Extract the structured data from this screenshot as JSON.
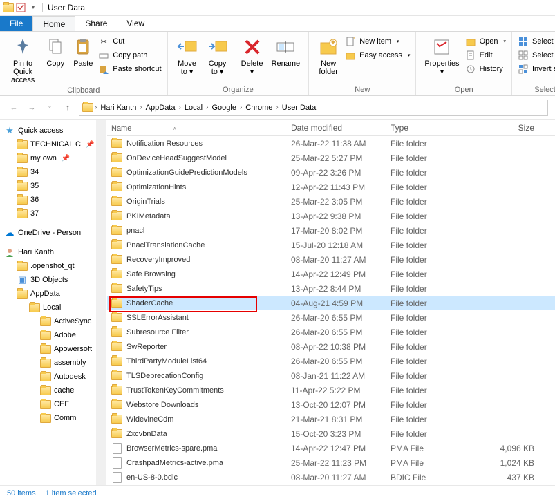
{
  "title_bar": {
    "title": "User Data"
  },
  "tabs": {
    "file": "File",
    "home": "Home",
    "share": "Share",
    "view": "View"
  },
  "ribbon": {
    "clipboard": {
      "label": "Clipboard",
      "pin": "Pin to Quick\naccess",
      "copy": "Copy",
      "paste": "Paste",
      "cut": "Cut",
      "copy_path": "Copy path",
      "paste_shortcut": "Paste shortcut"
    },
    "organize": {
      "label": "Organize",
      "move_to": "Move\nto",
      "copy_to": "Copy\nto",
      "delete": "Delete",
      "rename": "Rename"
    },
    "new": {
      "label": "New",
      "new_folder": "New\nfolder",
      "new_item": "New item",
      "easy_access": "Easy access"
    },
    "open": {
      "label": "Open",
      "properties": "Properties",
      "open": "Open",
      "edit": "Edit",
      "history": "History"
    },
    "select": {
      "label": "Select",
      "select_all": "Select all",
      "select_none": "Select none",
      "invert": "Invert selection"
    }
  },
  "breadcrumb": [
    "Hari Kanth",
    "AppData",
    "Local",
    "Google",
    "Chrome",
    "User Data"
  ],
  "tree": {
    "quick_access": "Quick access",
    "technical": "TECHNICAL C",
    "my_own": "my own",
    "f34": "34",
    "f35": "35",
    "f36": "36",
    "f37": "37",
    "onedrive": "OneDrive - Person",
    "user": "Hari Kanth",
    "openshot": ".openshot_qt",
    "objects3d": "3D Objects",
    "appdata": "AppData",
    "local": "Local",
    "activesync": "ActiveSync",
    "adobe": "Adobe",
    "apowersoft": "Apowersoft",
    "assembly": "assembly",
    "autodesk": "Autodesk",
    "cache": "cache",
    "cef": "CEF",
    "comms": "Comms"
  },
  "columns": {
    "name": "Name",
    "date": "Date modified",
    "type": "Type",
    "size": "Size"
  },
  "files": [
    {
      "name": "Notification Resources",
      "date": "26-Mar-22 11:38 AM",
      "type": "File folder",
      "size": "",
      "icon": "folder"
    },
    {
      "name": "OnDeviceHeadSuggestModel",
      "date": "25-Mar-22 5:27 PM",
      "type": "File folder",
      "size": "",
      "icon": "folder"
    },
    {
      "name": "OptimizationGuidePredictionModels",
      "date": "09-Apr-22 3:26 PM",
      "type": "File folder",
      "size": "",
      "icon": "folder"
    },
    {
      "name": "OptimizationHints",
      "date": "12-Apr-22 11:43 PM",
      "type": "File folder",
      "size": "",
      "icon": "folder"
    },
    {
      "name": "OriginTrials",
      "date": "25-Mar-22 3:05 PM",
      "type": "File folder",
      "size": "",
      "icon": "folder"
    },
    {
      "name": "PKIMetadata",
      "date": "13-Apr-22 9:38 PM",
      "type": "File folder",
      "size": "",
      "icon": "folder"
    },
    {
      "name": "pnacl",
      "date": "17-Mar-20 8:02 PM",
      "type": "File folder",
      "size": "",
      "icon": "folder"
    },
    {
      "name": "PnaclTranslationCache",
      "date": "15-Jul-20 12:18 AM",
      "type": "File folder",
      "size": "",
      "icon": "folder"
    },
    {
      "name": "RecoveryImproved",
      "date": "08-Mar-20 11:27 AM",
      "type": "File folder",
      "size": "",
      "icon": "folder"
    },
    {
      "name": "Safe Browsing",
      "date": "14-Apr-22 12:49 PM",
      "type": "File folder",
      "size": "",
      "icon": "folder"
    },
    {
      "name": "SafetyTips",
      "date": "13-Apr-22 8:44 PM",
      "type": "File folder",
      "size": "",
      "icon": "folder"
    },
    {
      "name": "ShaderCache",
      "date": "04-Aug-21 4:59 PM",
      "type": "File folder",
      "size": "",
      "icon": "folder",
      "selected": true
    },
    {
      "name": "SSLErrorAssistant",
      "date": "26-Mar-20 6:55 PM",
      "type": "File folder",
      "size": "",
      "icon": "folder"
    },
    {
      "name": "Subresource Filter",
      "date": "26-Mar-20 6:55 PM",
      "type": "File folder",
      "size": "",
      "icon": "folder"
    },
    {
      "name": "SwReporter",
      "date": "08-Apr-22 10:38 PM",
      "type": "File folder",
      "size": "",
      "icon": "folder"
    },
    {
      "name": "ThirdPartyModuleList64",
      "date": "26-Mar-20 6:55 PM",
      "type": "File folder",
      "size": "",
      "icon": "folder"
    },
    {
      "name": "TLSDeprecationConfig",
      "date": "08-Jan-21 11:22 AM",
      "type": "File folder",
      "size": "",
      "icon": "folder"
    },
    {
      "name": "TrustTokenKeyCommitments",
      "date": "11-Apr-22 5:22 PM",
      "type": "File folder",
      "size": "",
      "icon": "folder"
    },
    {
      "name": "Webstore Downloads",
      "date": "13-Oct-20 12:07 PM",
      "type": "File folder",
      "size": "",
      "icon": "folder"
    },
    {
      "name": "WidevineCdm",
      "date": "21-Mar-21 8:31 PM",
      "type": "File folder",
      "size": "",
      "icon": "folder"
    },
    {
      "name": "ZxcvbnData",
      "date": "15-Oct-20 3:23 PM",
      "type": "File folder",
      "size": "",
      "icon": "folder"
    },
    {
      "name": "BrowserMetrics-spare.pma",
      "date": "14-Apr-22 12:47 PM",
      "type": "PMA File",
      "size": "4,096 KB",
      "icon": "file"
    },
    {
      "name": "CrashpadMetrics-active.pma",
      "date": "25-Mar-22 11:23 PM",
      "type": "PMA File",
      "size": "1,024 KB",
      "icon": "file"
    },
    {
      "name": "en-US-8-0.bdic",
      "date": "08-Mar-20 11:27 AM",
      "type": "BDIC File",
      "size": "437 KB",
      "icon": "file"
    }
  ],
  "status": {
    "count": "50 items",
    "selected": "1 item selected"
  }
}
